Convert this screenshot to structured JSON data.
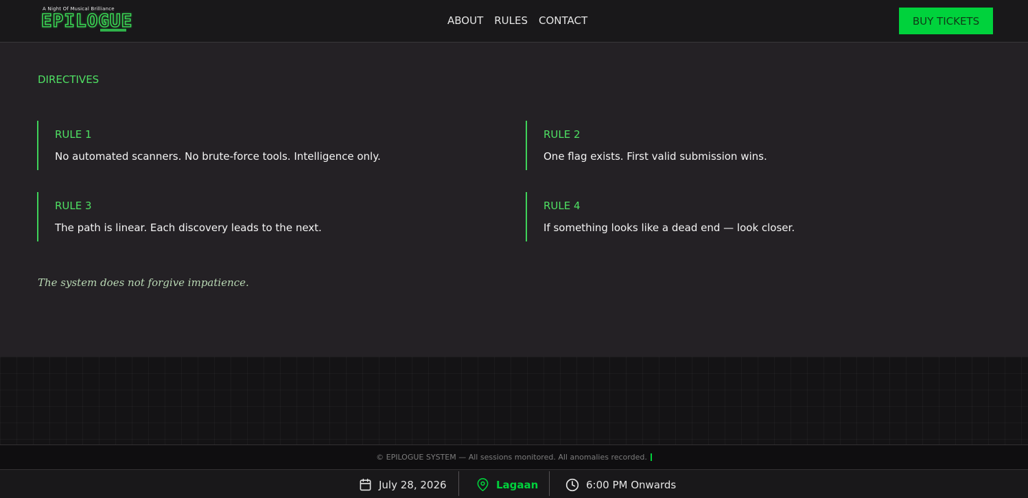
{
  "header": {
    "logo_tagline": "A Night Of Musical Brilliance",
    "logo_word": "EPILOGUE",
    "nav": [
      "ABOUT",
      "RULES",
      "CONTACT"
    ],
    "buy_label": "BUY TICKETS"
  },
  "main": {
    "section_title": "DIRECTIVES",
    "rules": [
      {
        "title": "RULE 1",
        "text": "No automated scanners. No brute-force tools. Intelligence only."
      },
      {
        "title": "RULE 2",
        "text": "One flag exists. First valid submission wins."
      },
      {
        "title": "RULE 3",
        "text": "The path is linear. Each discovery leads to the next."
      },
      {
        "title": "RULE 4",
        "text": "If something looks like a dead end — look closer."
      }
    ],
    "warning": "The system does not forgive impatience."
  },
  "footer": {
    "copyright": "© EPILOGUE SYSTEM — All sessions monitored. All anomalies recorded.",
    "date": "July 28, 2026",
    "venue": "Lagaan",
    "time": "6:00 PM Onwards",
    "icons": {
      "date": "calendar-icon",
      "venue": "location-pin-icon",
      "time": "clock-icon"
    }
  },
  "colors": {
    "accent": "#00d23c",
    "accent_text": "#4fe063",
    "background": "#242125",
    "header": "#19181a"
  }
}
